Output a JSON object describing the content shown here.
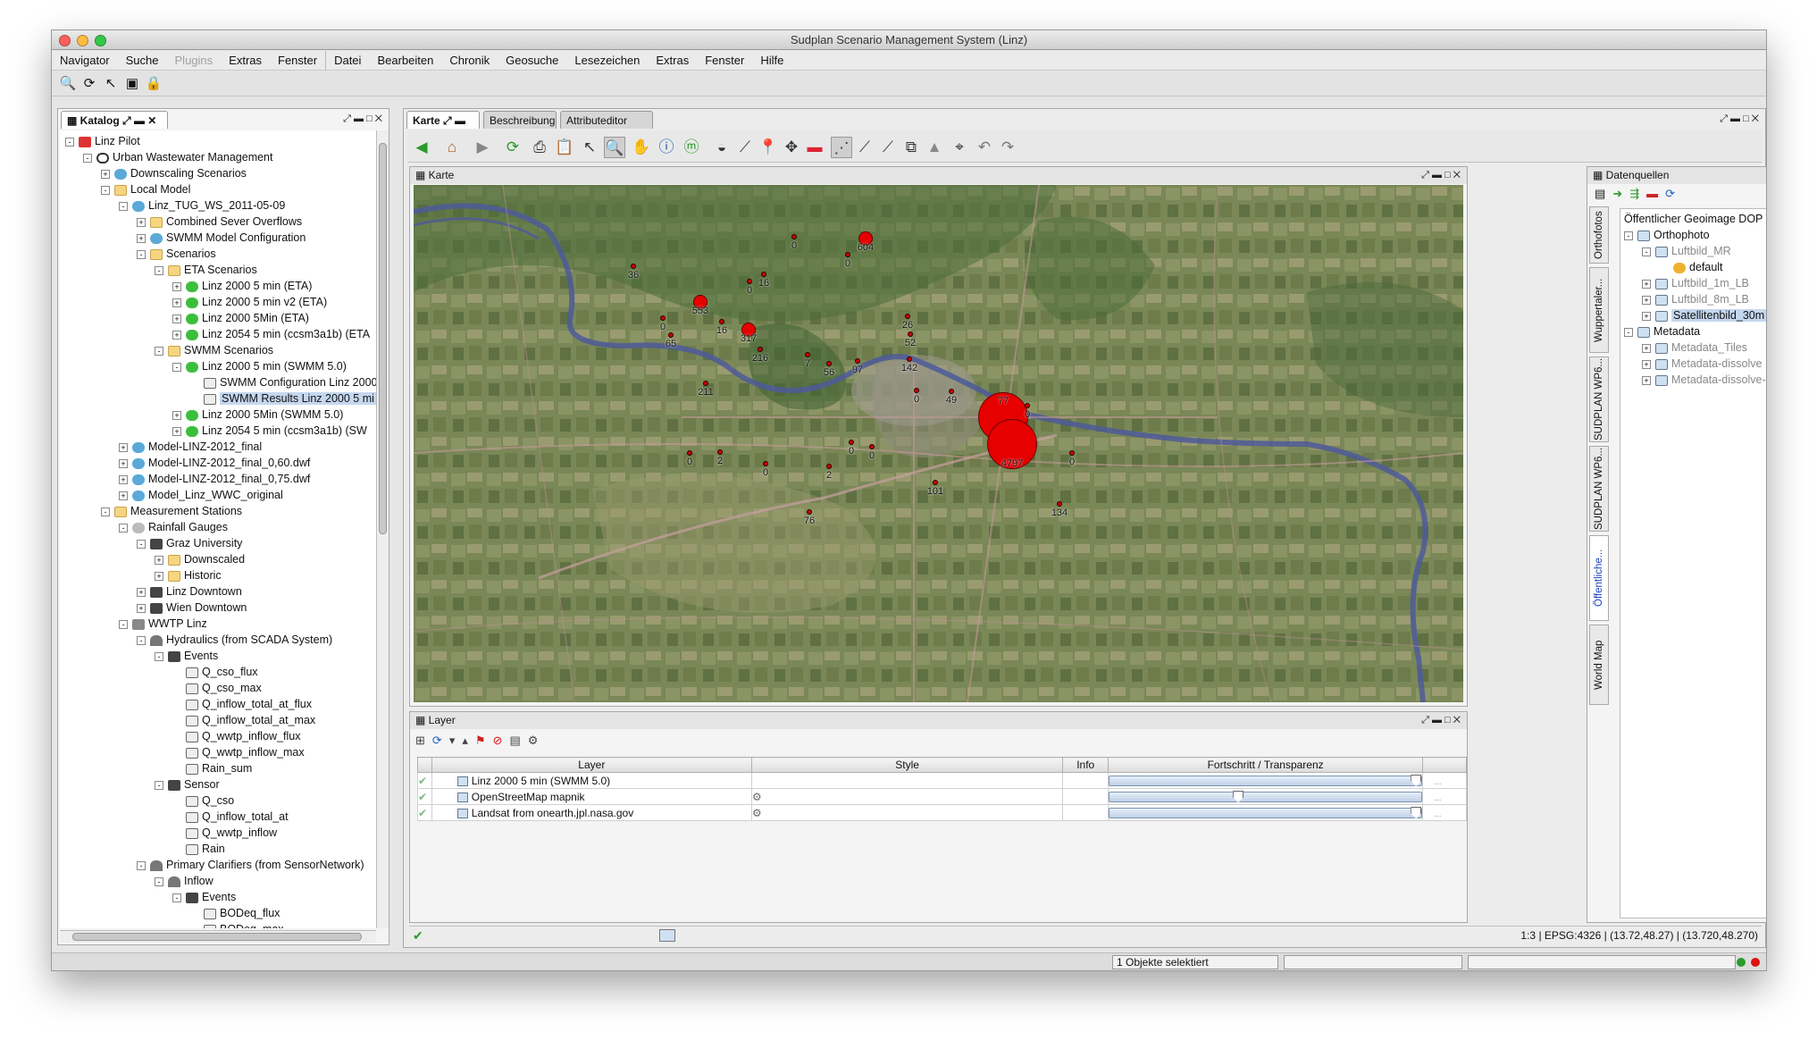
{
  "window": {
    "title": "Sudplan Scenario Management System (Linz)"
  },
  "menus": [
    {
      "label": "Navigator",
      "disabled": false
    },
    {
      "label": "Suche",
      "disabled": false
    },
    {
      "label": "Plugins",
      "disabled": true
    },
    {
      "label": "Extras",
      "disabled": false
    },
    {
      "label": "Fenster",
      "disabled": false
    },
    {
      "label": "Datei",
      "disabled": false
    },
    {
      "label": "Bearbeiten",
      "disabled": false
    },
    {
      "label": "Chronik",
      "disabled": false
    },
    {
      "label": "Geosuche",
      "disabled": false
    },
    {
      "label": "Lesezeichen",
      "disabled": false
    },
    {
      "label": "Extras",
      "disabled": false
    },
    {
      "label": "Fenster",
      "disabled": false
    },
    {
      "label": "Hilfe",
      "disabled": false
    }
  ],
  "catalog": {
    "tab": "Katalog",
    "tree": [
      {
        "d": 0,
        "ex": "-",
        "icon": "pilot",
        "label": "Linz Pilot"
      },
      {
        "d": 1,
        "ex": "-",
        "icon": "globe",
        "label": "Urban Wastewater Management"
      },
      {
        "d": 2,
        "ex": "+",
        "icon": "sw",
        "label": "Downscaling Scenarios"
      },
      {
        "d": 2,
        "ex": "-",
        "icon": "f",
        "label": "Local Model"
      },
      {
        "d": 3,
        "ex": "-",
        "icon": "sw",
        "label": "Linz_TUG_WS_2011-05-09"
      },
      {
        "d": 4,
        "ex": "+",
        "icon": "f",
        "label": "Combined Sever Overflows"
      },
      {
        "d": 4,
        "ex": "+",
        "icon": "sw",
        "label": "SWMM Model Configuration"
      },
      {
        "d": 4,
        "ex": "-",
        "icon": "f",
        "label": "Scenarios"
      },
      {
        "d": 5,
        "ex": "-",
        "icon": "f",
        "label": "ETA Scenarios"
      },
      {
        "d": 6,
        "ex": "+",
        "icon": "gr",
        "label": "Linz 2000 5 min (ETA)"
      },
      {
        "d": 6,
        "ex": "+",
        "icon": "gr",
        "label": "Linz 2000 5 min v2 (ETA)"
      },
      {
        "d": 6,
        "ex": "+",
        "icon": "gr",
        "label": "Linz 2000 5Min (ETA)"
      },
      {
        "d": 6,
        "ex": "+",
        "icon": "gr",
        "label": "Linz 2054 5 min (ccsm3a1b) (ETA"
      },
      {
        "d": 5,
        "ex": "-",
        "icon": "f",
        "label": "SWMM Scenarios"
      },
      {
        "d": 6,
        "ex": "-",
        "icon": "gr",
        "label": "Linz 2000 5 min (SWMM 5.0)"
      },
      {
        "d": 7,
        "ex": "",
        "icon": "ch",
        "label": "SWMM Configuration Linz 2000"
      },
      {
        "d": 7,
        "ex": "",
        "icon": "ch",
        "label": "SWMM Results Linz 2000 5 mi",
        "selected": true
      },
      {
        "d": 6,
        "ex": "+",
        "icon": "gr",
        "label": "Linz 2000 5Min (SWMM 5.0)"
      },
      {
        "d": 6,
        "ex": "+",
        "icon": "gr",
        "label": "Linz 2054 5 min (ccsm3a1b) (SW"
      },
      {
        "d": 3,
        "ex": "+",
        "icon": "sw",
        "label": "Model-LINZ-2012_final"
      },
      {
        "d": 3,
        "ex": "+",
        "icon": "sw",
        "label": "Model-LINZ-2012_final_0,60.dwf"
      },
      {
        "d": 3,
        "ex": "+",
        "icon": "sw",
        "label": "Model-LINZ-2012_final_0,75.dwf"
      },
      {
        "d": 3,
        "ex": "+",
        "icon": "sw",
        "label": "Model_Linz_WWC_original"
      },
      {
        "d": 2,
        "ex": "-",
        "icon": "f",
        "label": "Measurement Stations"
      },
      {
        "d": 3,
        "ex": "-",
        "icon": "cloud",
        "label": "Rainfall Gauges"
      },
      {
        "d": 4,
        "ex": "-",
        "icon": "ev",
        "label": "Graz University"
      },
      {
        "d": 5,
        "ex": "+",
        "icon": "f",
        "label": "Downscaled"
      },
      {
        "d": 5,
        "ex": "+",
        "icon": "f",
        "label": "Historic"
      },
      {
        "d": 4,
        "ex": "+",
        "icon": "ev",
        "label": "Linz Downtown"
      },
      {
        "d": 4,
        "ex": "+",
        "icon": "ev",
        "label": "Wien Downtown"
      },
      {
        "d": 3,
        "ex": "-",
        "icon": "plant",
        "label": "WWTP Linz"
      },
      {
        "d": 4,
        "ex": "-",
        "icon": "hy",
        "label": "Hydraulics (from SCADA System)"
      },
      {
        "d": 5,
        "ex": "-",
        "icon": "ev",
        "label": "Events"
      },
      {
        "d": 6,
        "ex": "",
        "icon": "ch",
        "label": "Q_cso_flux"
      },
      {
        "d": 6,
        "ex": "",
        "icon": "ch",
        "label": "Q_cso_max"
      },
      {
        "d": 6,
        "ex": "",
        "icon": "ch",
        "label": "Q_inflow_total_at_flux"
      },
      {
        "d": 6,
        "ex": "",
        "icon": "ch",
        "label": "Q_inflow_total_at_max"
      },
      {
        "d": 6,
        "ex": "",
        "icon": "ch",
        "label": "Q_wwtp_inflow_flux"
      },
      {
        "d": 6,
        "ex": "",
        "icon": "ch",
        "label": "Q_wwtp_inflow_max"
      },
      {
        "d": 6,
        "ex": "",
        "icon": "ch",
        "label": "Rain_sum"
      },
      {
        "d": 5,
        "ex": "-",
        "icon": "ev",
        "label": "Sensor"
      },
      {
        "d": 6,
        "ex": "",
        "icon": "ch",
        "label": "Q_cso"
      },
      {
        "d": 6,
        "ex": "",
        "icon": "ch",
        "label": "Q_inflow_total_at"
      },
      {
        "d": 6,
        "ex": "",
        "icon": "ch",
        "label": "Q_wwtp_inflow"
      },
      {
        "d": 6,
        "ex": "",
        "icon": "ch",
        "label": "Rain"
      },
      {
        "d": 4,
        "ex": "-",
        "icon": "hy",
        "label": "Primary Clarifiers (from SensorNetwork)"
      },
      {
        "d": 5,
        "ex": "-",
        "icon": "hy",
        "label": "Inflow"
      },
      {
        "d": 6,
        "ex": "-",
        "icon": "ev",
        "label": "Events"
      },
      {
        "d": 7,
        "ex": "",
        "icon": "ch",
        "label": "BODeq_flux"
      },
      {
        "d": 7,
        "ex": "",
        "icon": "ch",
        "label": "BODeq_max"
      }
    ]
  },
  "center_tabs": [
    "Karte",
    "Beschreibung",
    "Attributeditor"
  ],
  "karte": {
    "title": "Karte"
  },
  "map_markers": [
    {
      "label": "0",
      "size": "dot"
    },
    {
      "label": "604",
      "size": "small"
    },
    {
      "label": "0",
      "size": "dot"
    },
    {
      "label": "36",
      "size": "dot"
    },
    {
      "label": "16",
      "size": "dot"
    },
    {
      "label": "0",
      "size": "dot"
    },
    {
      "label": "553",
      "size": "small"
    },
    {
      "label": "0",
      "size": "dot"
    },
    {
      "label": "16",
      "size": "dot"
    },
    {
      "label": "65",
      "size": "dot"
    },
    {
      "label": "317",
      "size": "small"
    },
    {
      "label": "216",
      "size": "dot"
    },
    {
      "label": "7",
      "size": "dot"
    },
    {
      "label": "56",
      "size": "dot"
    },
    {
      "label": "97",
      "size": "dot"
    },
    {
      "label": "26",
      "size": "dot"
    },
    {
      "label": "52",
      "size": "dot"
    },
    {
      "label": "142",
      "size": "dot"
    },
    {
      "label": "211",
      "size": "dot"
    },
    {
      "label": "0",
      "size": "dot"
    },
    {
      "label": "49",
      "size": "dot"
    },
    {
      "label": "0",
      "size": "dot"
    },
    {
      "label": "77",
      "size": "large"
    },
    {
      "label": "0",
      "size": "dot"
    },
    {
      "label": "4797",
      "size": "large"
    },
    {
      "label": "0",
      "size": "dot"
    },
    {
      "label": "0",
      "size": "dot"
    },
    {
      "label": "2",
      "size": "dot"
    },
    {
      "label": "0",
      "size": "dot"
    },
    {
      "label": "0",
      "size": "dot"
    },
    {
      "label": "2",
      "size": "dot"
    },
    {
      "label": "0",
      "size": "dot"
    },
    {
      "label": "101",
      "size": "dot"
    },
    {
      "label": "134",
      "size": "dot"
    },
    {
      "label": "76",
      "size": "dot"
    }
  ],
  "layer": {
    "title": "Layer",
    "columns": [
      "Layer",
      "Style",
      "Info",
      "Fortschritt / Transparenz"
    ],
    "rows": [
      {
        "name": "Linz 2000 5 min (SWMM 5.0)",
        "opacity": 1.0
      },
      {
        "name": "OpenStreetMap mapnik",
        "opacity": 0.43
      },
      {
        "name": "Landsat from onearth.jpl.nasa.gov",
        "opacity": 1.0
      }
    ]
  },
  "datasources": {
    "title": "Datenquellen",
    "tree": [
      {
        "d": 0,
        "ex": "",
        "label": "Öffentlicher Geoimage DOP WMS MaxRe"
      },
      {
        "d": 0,
        "ex": "-",
        "label": "Orthophoto"
      },
      {
        "d": 1,
        "ex": "-",
        "label": "Luftbild_MR",
        "grey": true
      },
      {
        "d": 2,
        "ex": "",
        "label": "default",
        "style": true
      },
      {
        "d": 1,
        "ex": "+",
        "label": "Luftbild_1m_LB",
        "grey": true
      },
      {
        "d": 1,
        "ex": "+",
        "label": "Luftbild_8m_LB",
        "grey": true
      },
      {
        "d": 1,
        "ex": "+",
        "label": "Satellitenbild_30m",
        "selected": true
      },
      {
        "d": 0,
        "ex": "-",
        "label": "Metadata"
      },
      {
        "d": 1,
        "ex": "+",
        "label": "Metadata_Tiles",
        "grey": true
      },
      {
        "d": 1,
        "ex": "+",
        "label": "Metadata-dissolve",
        "grey": true
      },
      {
        "d": 1,
        "ex": "+",
        "label": "Metadata-dissolve-res",
        "grey": true
      }
    ],
    "side_tabs": [
      "Orthofotos",
      "Wuppertaler...",
      "SUDPLAN WP6...",
      "SUDPLAN WP6...",
      "Öffentliche...",
      "World Map"
    ]
  },
  "status": {
    "scale": "1:3",
    "crs": "EPSG:4326",
    "coords1": "(13.72,48.27)",
    "coords2": "(13.720,48.270)",
    "selection": "1 Objekte selektiert"
  },
  "colors": {
    "marker": "#e60000",
    "selected_bg": "#c5d7ef",
    "active_side_tab": "#1a3fbf"
  }
}
